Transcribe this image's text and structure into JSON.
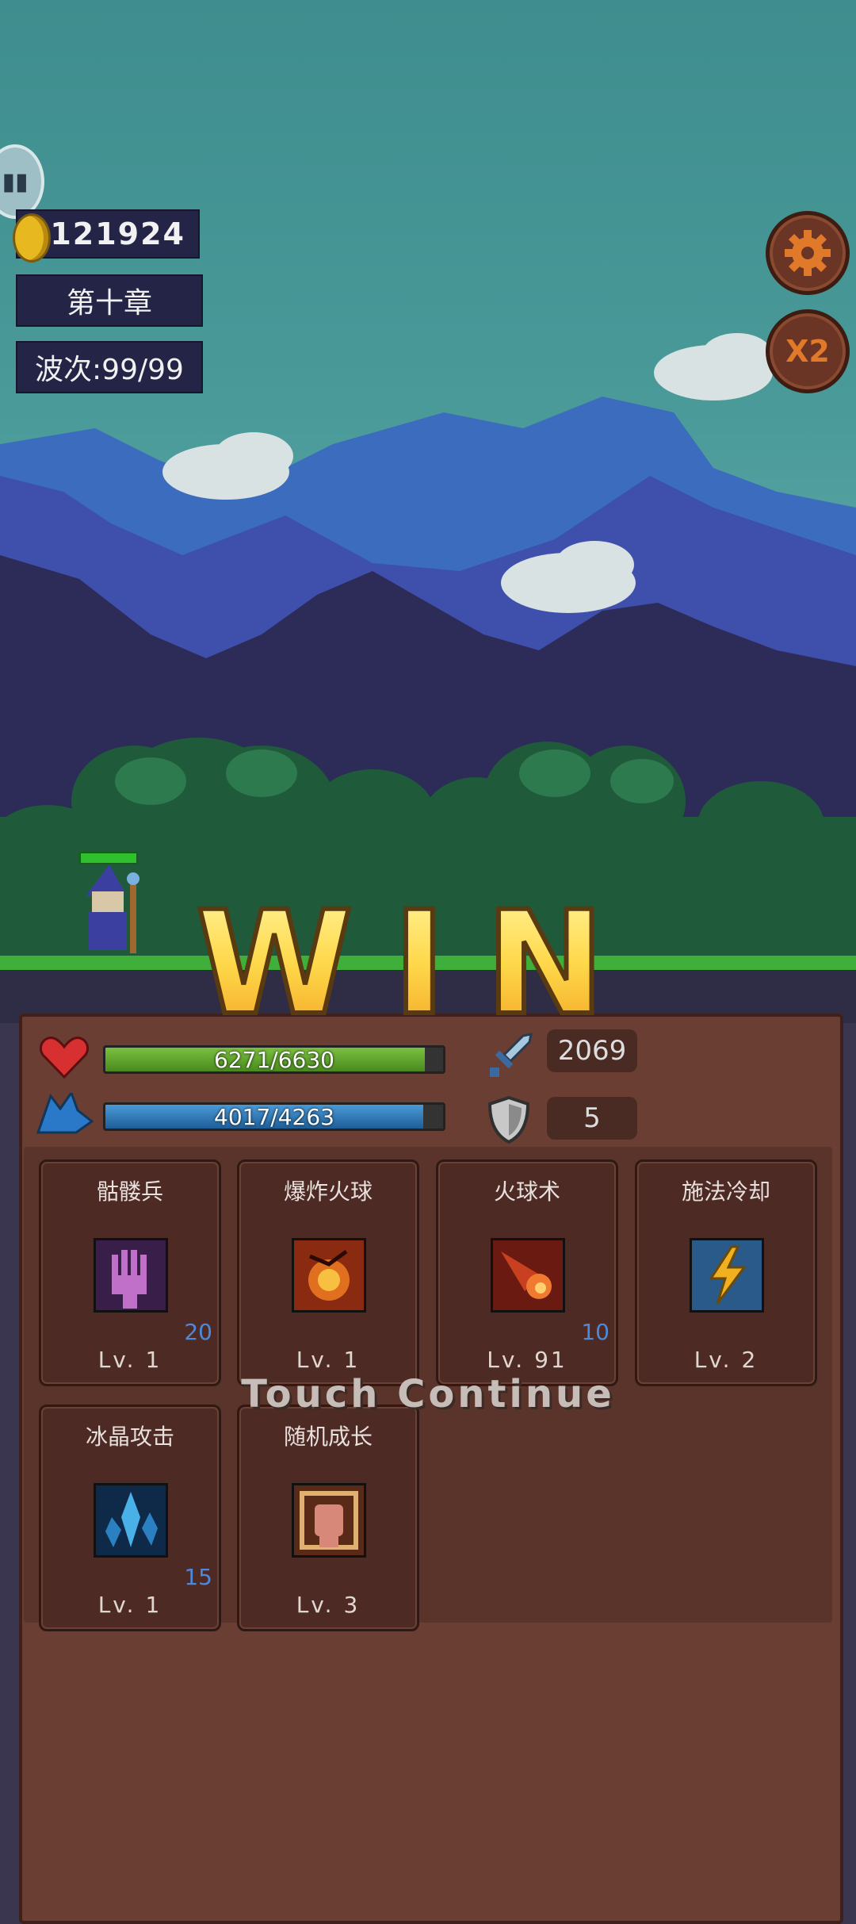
{
  "hud": {
    "coins": "121924",
    "chapter": "第十章",
    "wave": "波次:99/99"
  },
  "buttons": {
    "settings_icon": "gear-icon",
    "speed_label": "X2"
  },
  "banner": {
    "win_text": "WIN",
    "touch_continue": "Touch Continue"
  },
  "stats": {
    "hp": {
      "text": "6271/6630",
      "fraction": 0.946
    },
    "mp": {
      "text": "4017/4263",
      "fraction": 0.942
    },
    "attack": "2069",
    "defense": "5"
  },
  "skills": [
    {
      "name": "骷髅兵",
      "level": "Lv. 1",
      "count": "20",
      "icon": "skeleton-hand-icon"
    },
    {
      "name": "爆炸火球",
      "level": "Lv. 1",
      "count": "",
      "icon": "explosion-icon"
    },
    {
      "name": "火球术",
      "level": "Lv. 91",
      "count": "10",
      "icon": "fireball-icon"
    },
    {
      "name": "施法冷却",
      "level": "Lv. 2",
      "count": "",
      "icon": "lightning-icon"
    },
    {
      "name": "冰晶攻击",
      "level": "Lv. 1",
      "count": "15",
      "icon": "ice-crystal-icon"
    },
    {
      "name": "随机成长",
      "level": "Lv. 3",
      "count": "",
      "icon": "fist-icon"
    }
  ],
  "colors": {
    "hp_bar": "#5aa02a",
    "mp_bar": "#2a78b4",
    "panel": "#6a3e32",
    "win_text": "#ffd84a"
  }
}
